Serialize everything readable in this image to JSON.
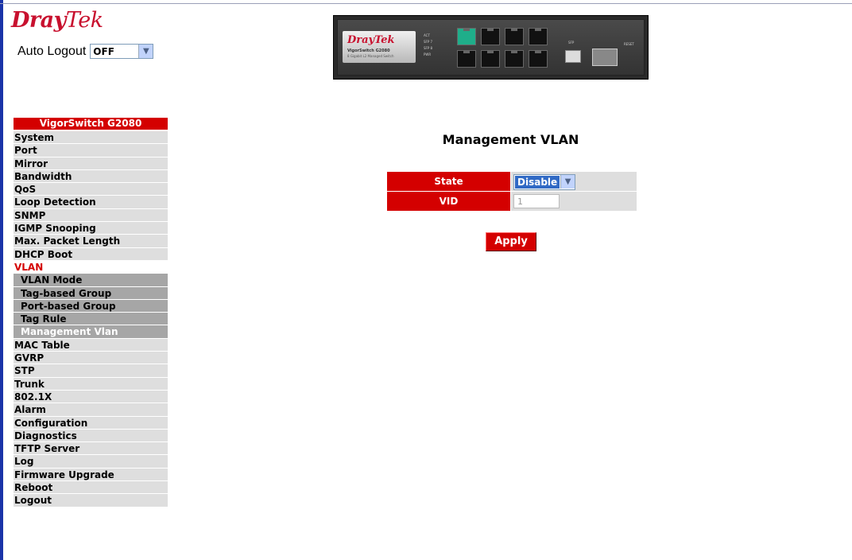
{
  "brand": {
    "logo_text_bold": "Dray",
    "logo_text_regular": "Tek"
  },
  "auto_logout": {
    "label": "Auto Logout",
    "value": "OFF"
  },
  "device_image": {
    "badge_brand": "DrayTek",
    "badge_model": "VigorSwitch G2080",
    "badge_desc": "8 Gigabit L2 Managed Switch",
    "leds": [
      "ACT",
      "SFP 7",
      "SFP 8",
      "PWR"
    ],
    "sfp_label": "SFP",
    "reset_label": "RESET"
  },
  "menu": {
    "header": "VigorSwitch G2080",
    "items": [
      "System",
      "Port",
      "Mirror",
      "Bandwidth",
      "QoS",
      "Loop Detection",
      "SNMP",
      "IGMP Snooping",
      "Max. Packet Length",
      "DHCP Boot",
      "VLAN"
    ],
    "vlan_sub": [
      "VLAN Mode",
      "Tag-based Group",
      "Port-based Group",
      "Tag Rule",
      "Management Vlan"
    ],
    "items_after": [
      "MAC Table",
      "GVRP",
      "STP",
      "Trunk",
      "802.1X",
      "Alarm",
      "Configuration",
      "Diagnostics",
      "TFTP Server",
      "Log",
      "Firmware Upgrade",
      "Reboot",
      "Logout"
    ]
  },
  "page": {
    "title": "Management VLAN",
    "state_label": "State",
    "state_value": "Disable",
    "vid_label": "VID",
    "vid_value": "1",
    "apply_label": "Apply"
  },
  "colors": {
    "accent_red": "#d40000",
    "menu_bg": "#dedede",
    "sub_bg": "#a6a6a6",
    "left_bar": "#1a33a8"
  }
}
